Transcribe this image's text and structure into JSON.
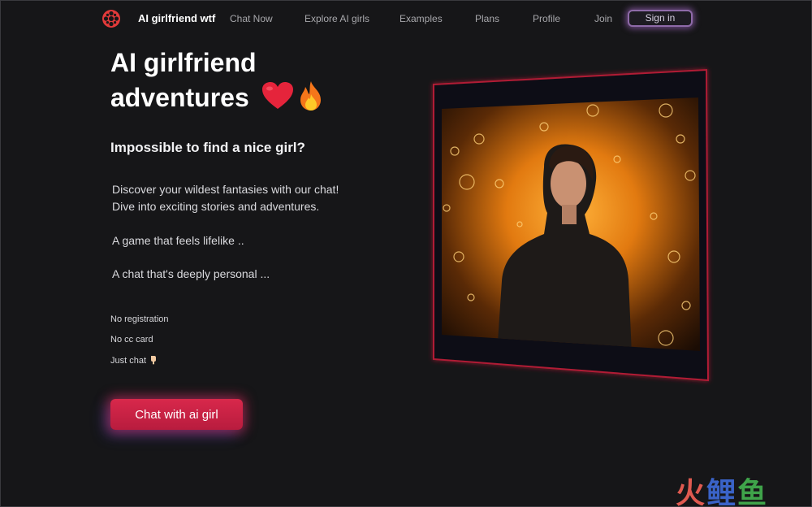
{
  "nav": {
    "brand": "AI girlfriend wtf",
    "links": [
      "Chat Now",
      "Explore AI girls",
      "Examples",
      "Plans",
      "Profile",
      "Join"
    ],
    "signin": "Sign in",
    "logo_icon": "film-reel-icon"
  },
  "hero": {
    "title": "AI girlfriend adventures",
    "emojis": [
      "heart-emoji",
      "fire-emoji"
    ],
    "subheading": "Impossible to find a nice girl?",
    "paragraphs": [
      "Discover your wildest fantasies with our chat!",
      "Dive into exciting stories and adventures.",
      "A game that feels lifelike ..",
      "A chat that's deeply personal ..."
    ],
    "features": [
      "No registration",
      "No cc card",
      "Just chat"
    ],
    "features_icon": "pointing-down-hand-emoji",
    "cta": "Chat with ai girl"
  },
  "image": {
    "subject": "illustration-woman-in-glowing-orb-tunnel"
  },
  "watermark": {
    "chars": [
      "火",
      "鲤",
      "鱼"
    ]
  },
  "colors": {
    "background": "#161618",
    "accent_red": "#d8284b",
    "signin_glow": "#be78e6"
  }
}
